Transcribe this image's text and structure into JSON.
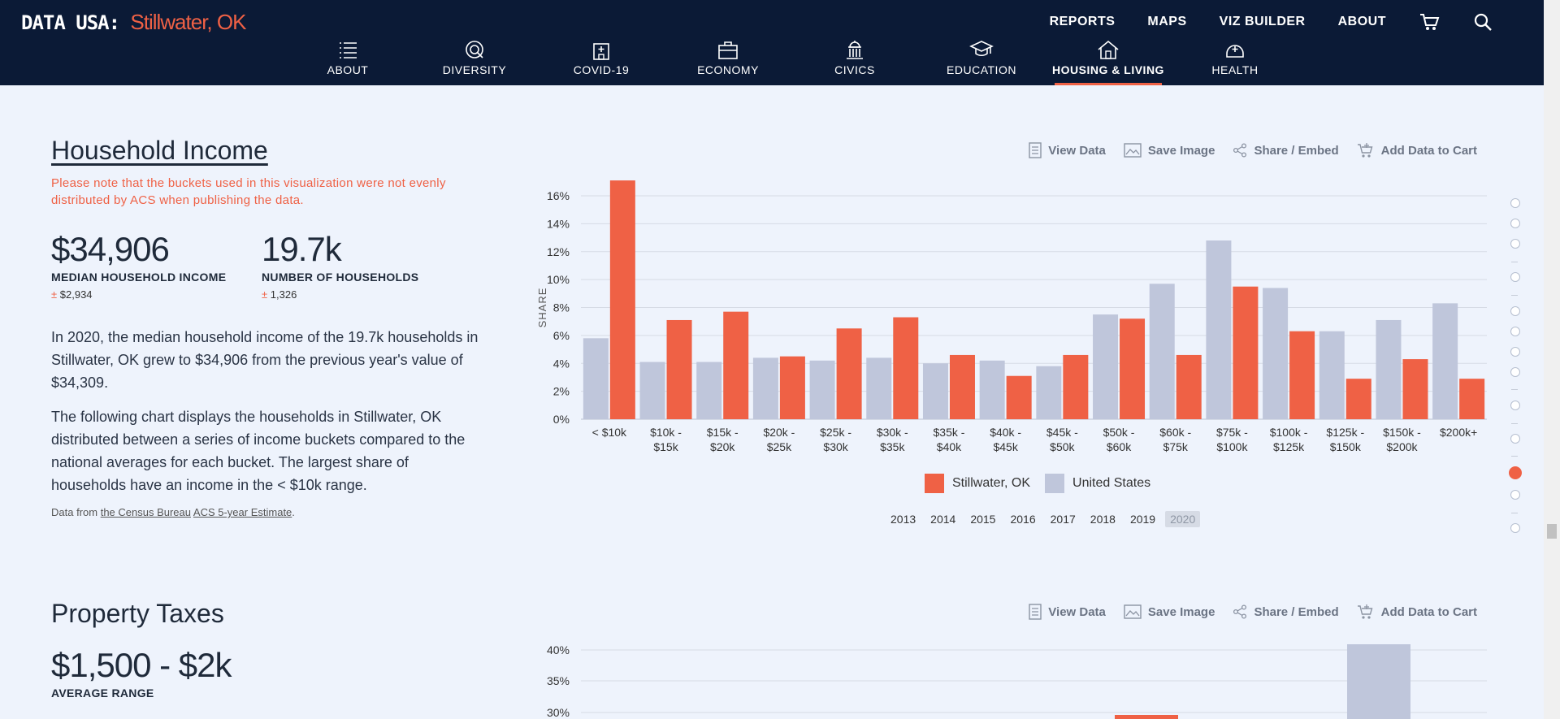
{
  "header": {
    "site": "DATA USA:",
    "place": "Stillwater, OK",
    "top_links": [
      "REPORTS",
      "MAPS",
      "VIZ BUILDER",
      "ABOUT"
    ],
    "sections": [
      {
        "label": "ABOUT",
        "icon": "list-icon"
      },
      {
        "label": "DIVERSITY",
        "icon": "diversity-icon"
      },
      {
        "label": "COVID-19",
        "icon": "hospital-icon"
      },
      {
        "label": "ECONOMY",
        "icon": "briefcase-icon"
      },
      {
        "label": "CIVICS",
        "icon": "capitol-icon"
      },
      {
        "label": "EDUCATION",
        "icon": "graduation-cap-icon"
      },
      {
        "label": "HOUSING & LIVING",
        "icon": "house-icon",
        "active": true
      },
      {
        "label": "HEALTH",
        "icon": "health-icon"
      }
    ]
  },
  "toolbar": {
    "view": "View Data",
    "save": "Save Image",
    "share": "Share / Embed",
    "cart": "Add Data to Cart"
  },
  "income": {
    "title": "Household Income",
    "note": "Please note that the buckets used in this visualization were not evenly distributed by ACS when publishing the data.",
    "median_value": "$34,906",
    "median_label": "MEDIAN HOUSEHOLD INCOME",
    "median_moe": "$2,934",
    "households_value": "19.7k",
    "households_label": "NUMBER OF HOUSEHOLDS",
    "households_moe": "1,326",
    "para1": "In 2020, the median household income of the 19.7k households in Stillwater, OK grew to $34,906 from the previous year's value of $34,309.",
    "para2": "The following chart displays the households in Stillwater, OK distributed between a series of income buckets compared to the national averages for each bucket. The largest share of households have an income in the < $10k range.",
    "source_prefix": "Data from",
    "source_org": "the Census Bureau",
    "source_dataset": "ACS 5-year Estimate",
    "source_suffix": ".",
    "years": [
      "2013",
      "2014",
      "2015",
      "2016",
      "2017",
      "2018",
      "2019",
      "2020"
    ],
    "active_year": "2020"
  },
  "property": {
    "title": "Property Taxes",
    "value": "$1,500 - $2k",
    "label": "AVERAGE RANGE"
  },
  "moe_symbol": "±",
  "colors": {
    "local": "#ef6145",
    "national": "#bfc6db",
    "nav_bg": "#0b1a36"
  },
  "chart_data": [
    {
      "type": "bar",
      "ylabel": "SHARE",
      "ylim": [
        0,
        16
      ],
      "yticks": [
        "0%",
        "2%",
        "4%",
        "6%",
        "8%",
        "10%",
        "12%",
        "14%",
        "16%"
      ],
      "categories": [
        "< $10k",
        "$10k - $15k",
        "$15k - $20k",
        "$20k - $25k",
        "$25k - $30k",
        "$30k - $35k",
        "$35k - $40k",
        "$40k - $45k",
        "$45k - $50k",
        "$50k - $60k",
        "$60k - $75k",
        "$75k - $100k",
        "$100k - $125k",
        "$125k - $150k",
        "$150k - $200k",
        "$200k+"
      ],
      "series": [
        {
          "name": "United States",
          "values": [
            5.8,
            4.1,
            4.1,
            4.4,
            4.2,
            4.4,
            4.0,
            4.2,
            3.8,
            7.5,
            9.7,
            12.8,
            9.4,
            6.3,
            7.1,
            8.3
          ]
        },
        {
          "name": "Stillwater, OK",
          "values": [
            17.1,
            7.1,
            7.7,
            4.5,
            6.5,
            7.3,
            4.6,
            3.1,
            4.6,
            7.2,
            4.6,
            9.5,
            6.3,
            2.9,
            4.3,
            2.9
          ]
        }
      ],
      "legend": "bottom"
    },
    {
      "type": "bar",
      "yticks": [
        "30%",
        "35%",
        "40%"
      ],
      "ylim": [
        30,
        40
      ],
      "note": "partially visible"
    }
  ]
}
